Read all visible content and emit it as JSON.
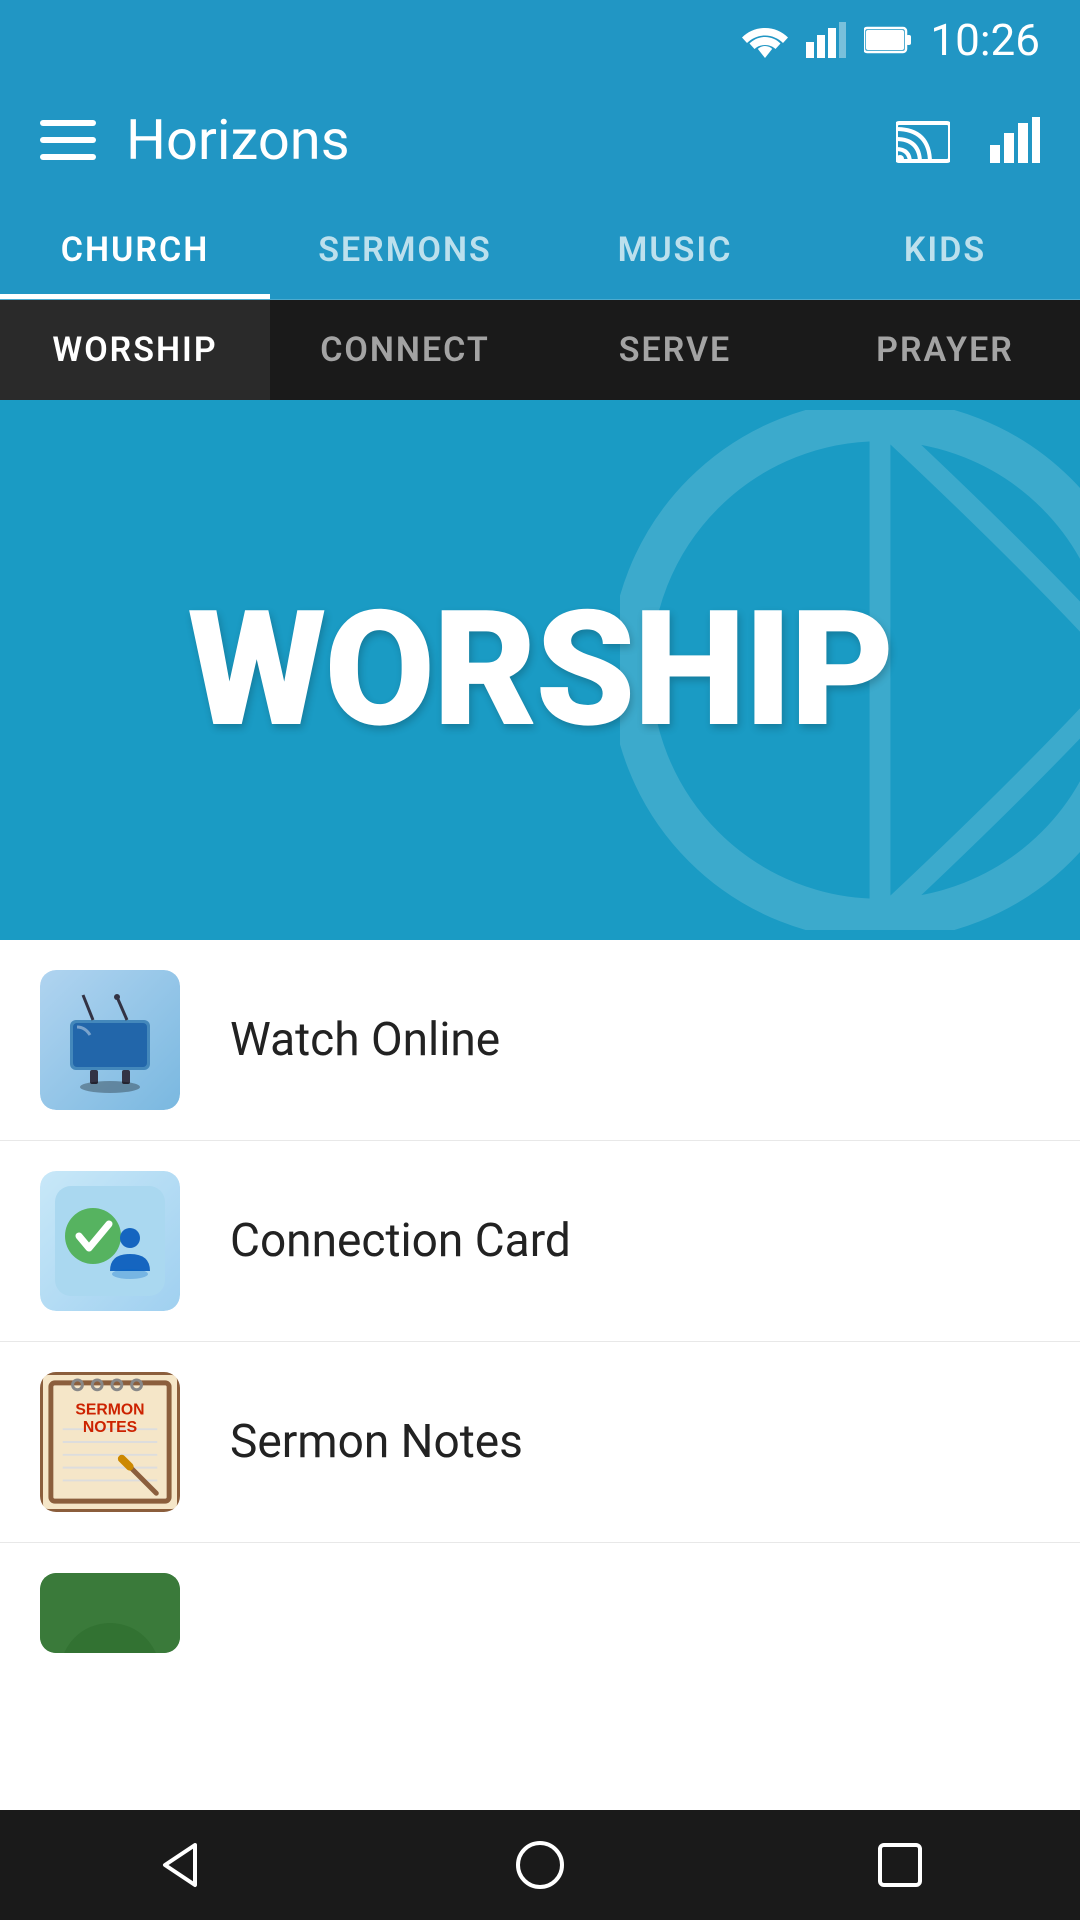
{
  "statusBar": {
    "time": "10:26"
  },
  "appBar": {
    "title": "Horizons",
    "menuLabel": "Menu",
    "castLabel": "Cast",
    "chartLabel": "Stats"
  },
  "topTabs": {
    "tabs": [
      {
        "id": "church",
        "label": "CHURCH",
        "active": true
      },
      {
        "id": "sermons",
        "label": "SERMONS",
        "active": false
      },
      {
        "id": "music",
        "label": "MUSIC",
        "active": false
      },
      {
        "id": "kids",
        "label": "KIDS",
        "active": false
      }
    ]
  },
  "secondaryTabs": {
    "tabs": [
      {
        "id": "worship",
        "label": "WORSHIP",
        "active": true
      },
      {
        "id": "connect",
        "label": "CONNECT",
        "active": false
      },
      {
        "id": "serve",
        "label": "SERVE",
        "active": false
      },
      {
        "id": "prayer",
        "label": "PRAYER",
        "active": false
      }
    ]
  },
  "heroBanner": {
    "title": "WORSHIP"
  },
  "listItems": [
    {
      "id": "watch-online",
      "label": "Watch Online",
      "iconType": "tv"
    },
    {
      "id": "connection-card",
      "label": "Connection Card",
      "iconType": "connection"
    },
    {
      "id": "sermon-notes",
      "label": "Sermon Notes",
      "iconType": "sermon"
    }
  ],
  "bottomNav": {
    "back": "◁",
    "home": "○",
    "recent": "□"
  }
}
